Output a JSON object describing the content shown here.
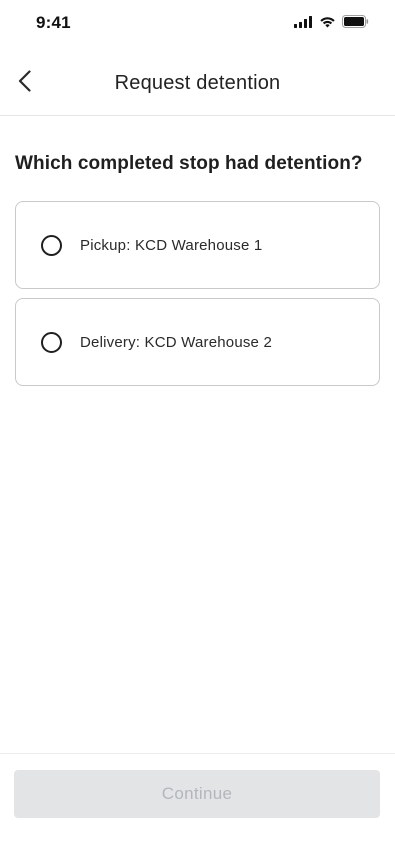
{
  "status_bar": {
    "time": "9:41"
  },
  "header": {
    "title": "Request detention"
  },
  "question": "Which completed stop had detention?",
  "options": [
    {
      "label": "Pickup: KCD Warehouse 1",
      "selected": false
    },
    {
      "label": "Delivery: KCD Warehouse 2",
      "selected": false
    }
  ],
  "footer": {
    "continue_label": "Continue",
    "continue_enabled": false
  },
  "colors": {
    "border": "#c9c9c9",
    "button_disabled_bg": "#e3e4e6",
    "button_disabled_text": "#b3b6bb"
  }
}
